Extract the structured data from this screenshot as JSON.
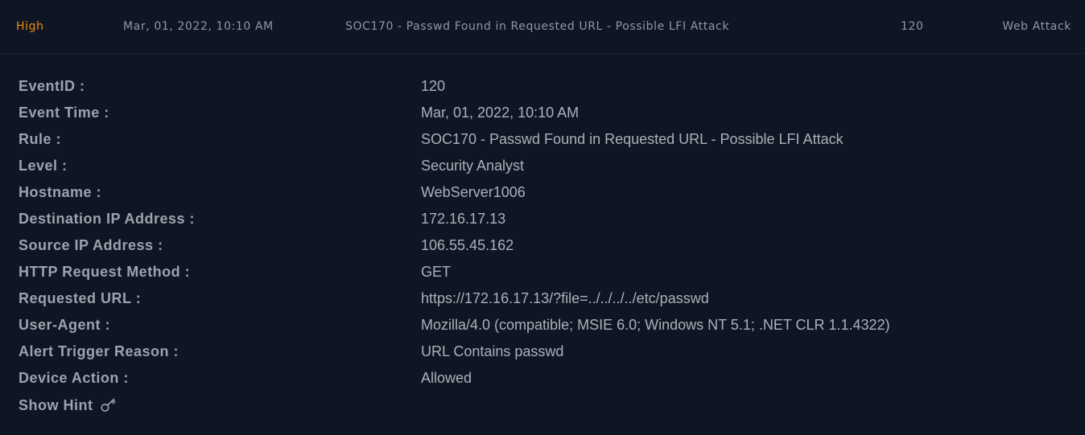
{
  "alert": {
    "level": "High",
    "date": "Mar, 01, 2022, 10:10 AM",
    "rule": "SOC170 - Passwd Found in Requested URL - Possible LFI Attack",
    "event_id": "120",
    "type": "Web Attack",
    "colors": {
      "level": "#e88c17"
    }
  },
  "details": [
    {
      "label": "EventID :",
      "value": "120"
    },
    {
      "label": "Event Time :",
      "value": "Mar, 01, 2022, 10:10 AM"
    },
    {
      "label": "Rule :",
      "value": "SOC170 - Passwd Found in Requested URL - Possible LFI Attack"
    },
    {
      "label": "Level :",
      "value": "Security Analyst"
    },
    {
      "label": "Hostname :",
      "value": "WebServer1006"
    },
    {
      "label": "Destination IP Address :",
      "value": "172.16.17.13"
    },
    {
      "label": "Source IP Address :",
      "value": "106.55.45.162"
    },
    {
      "label": "HTTP Request Method :",
      "value": "GET"
    },
    {
      "label": "Requested URL :",
      "value": "https://172.16.17.13/?file=../../../../etc/passwd"
    },
    {
      "label": "User-Agent :",
      "value": "Mozilla/4.0 (compatible; MSIE 6.0; Windows NT 5.1; .NET CLR 1.1.4322)"
    },
    {
      "label": "Alert Trigger Reason :",
      "value": "URL Contains passwd"
    },
    {
      "label": "Device Action :",
      "value": "Allowed"
    }
  ],
  "hint": {
    "label": "Show Hint",
    "icon": "key-icon"
  }
}
